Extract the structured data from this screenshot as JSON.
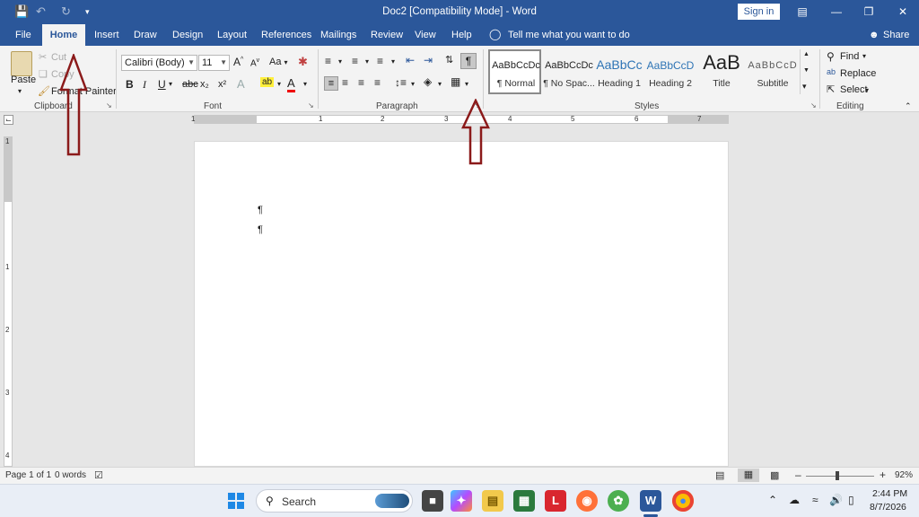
{
  "titlebar": {
    "title": "Doc2 [Compatibility Mode] - Word",
    "sign_in": "Sign in",
    "quick_access": [
      "save-icon",
      "undo-icon",
      "redo-icon",
      "customize-icon"
    ],
    "window_controls": [
      "ribbon-display-icon",
      "minimize-icon",
      "restore-icon",
      "close-icon"
    ]
  },
  "tabs": {
    "items": [
      "File",
      "Home",
      "Insert",
      "Draw",
      "Design",
      "Layout",
      "References",
      "Mailings",
      "Review",
      "View",
      "Help"
    ],
    "active": "Home",
    "tell_me": "Tell me what you want to do",
    "share": "Share"
  },
  "clipboard": {
    "paste": "Paste",
    "cut": "Cut",
    "copy": "Copy",
    "format_painter": "Format Painter",
    "label": "Clipboard"
  },
  "font": {
    "name": "Calibri (Body)",
    "size": "11",
    "change_case": "Aa",
    "label": "Font",
    "bold": "B",
    "italic": "I",
    "underline": "U",
    "strikethrough": "abc",
    "subscript": "x₂",
    "superscript": "x²",
    "text_effects": "A",
    "highlight": "ab",
    "font_color": "A",
    "grow": "A",
    "shrink": "A"
  },
  "paragraph": {
    "label": "Paragraph"
  },
  "styles": {
    "label": "Styles",
    "items": [
      {
        "preview": "AaBbCcDc",
        "name": "¶ Normal"
      },
      {
        "preview": "AaBbCcDc",
        "name": "¶ No Spac..."
      },
      {
        "preview": "AaBbCc",
        "name": "Heading 1"
      },
      {
        "preview": "AaBbCcD",
        "name": "Heading 2"
      },
      {
        "preview": "AaB",
        "name": "Title"
      },
      {
        "preview": "AaBbCcD",
        "name": "Subtitle"
      }
    ]
  },
  "editing": {
    "label": "Editing",
    "find": "Find",
    "replace": "Replace",
    "select": "Select"
  },
  "ruler": {
    "h_numbers": [
      "1",
      "1",
      "2",
      "3",
      "4",
      "5",
      "6",
      "7"
    ],
    "v_numbers": [
      "1",
      "1",
      "2",
      "3",
      "4"
    ]
  },
  "document": {
    "paragraph_marks": [
      "¶",
      "¶"
    ]
  },
  "status": {
    "page": "Page 1 of 1",
    "words": "0 words",
    "zoom": "92%"
  },
  "taskbar": {
    "search_placeholder": "Search",
    "time": "2:44 PM",
    "date": "8/7/2026"
  },
  "colors": {
    "word_blue": "#2b579a",
    "arrow": "#8b1a1a"
  }
}
